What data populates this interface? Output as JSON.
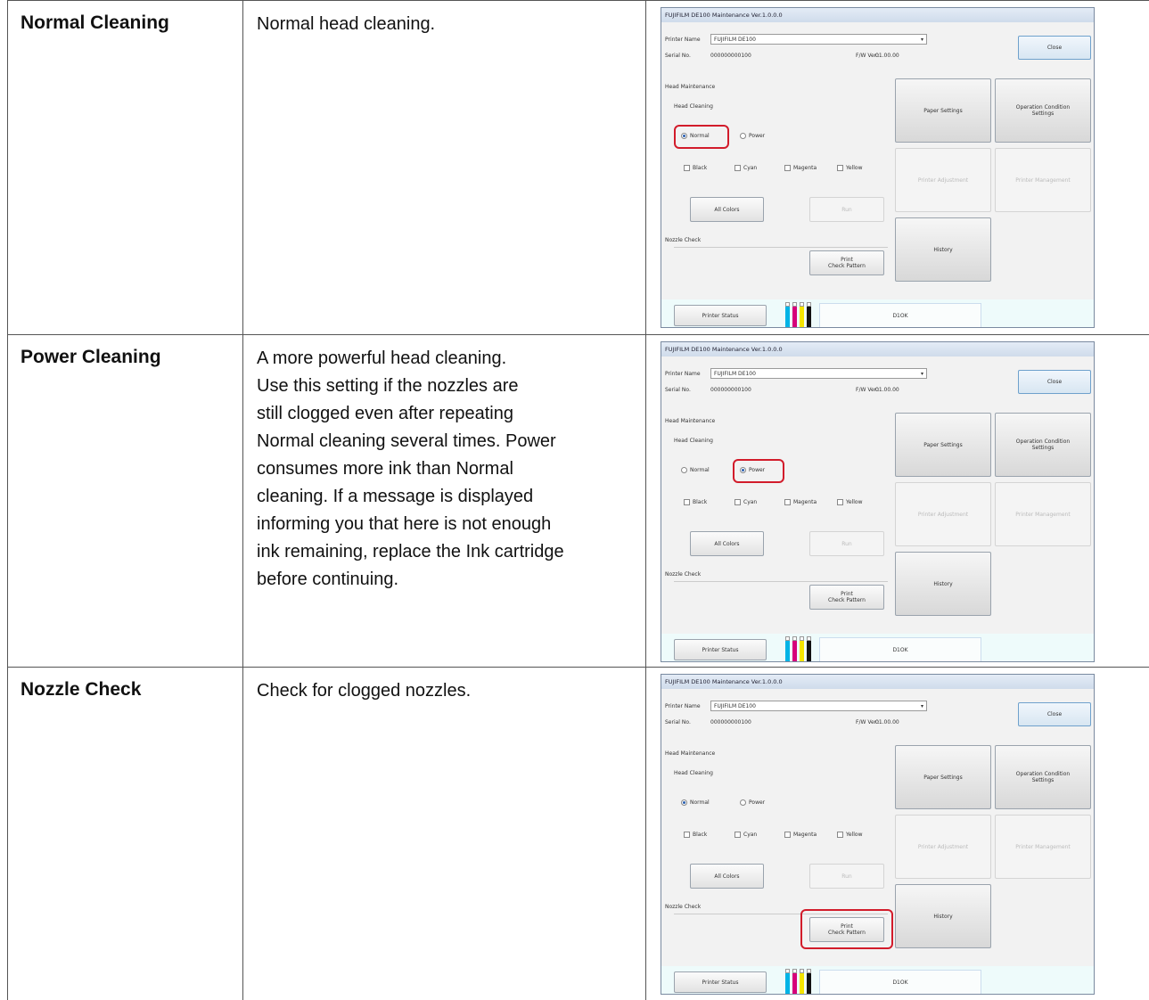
{
  "rows": [
    {
      "term": "Normal Cleaning",
      "description": [
        "Normal head cleaning."
      ],
      "highlight": "normal-radio"
    },
    {
      "term": "Power Cleaning",
      "description": [
        "A more powerful head cleaning.",
        "Use this setting if the nozzles are",
        "still clogged even after repeating",
        "Normal cleaning several times. Power",
        "consumes more ink than Normal",
        "cleaning. If a message is displayed",
        "informing you that here is not enough",
        "ink remaining, replace the Ink cartridge",
        "before continuing."
      ],
      "highlight": "power-radio"
    },
    {
      "term": "Nozzle Check",
      "description": [
        "Check for clogged nozzles."
      ],
      "highlight": "print-check-pattern"
    }
  ],
  "window": {
    "title": "FUJIFILM DE100 Maintenance Ver.1.0.0.0",
    "printer_name_label": "Printer Name",
    "printer_name_value": "FUJIFILM DE100",
    "serial_label": "Serial No.",
    "serial_value": "000000000100",
    "fw_label": "F/W Ver.:",
    "fw_value": "01.00.00",
    "close": "Close",
    "head_maintenance": "Head Maintenance",
    "head_cleaning": "Head Cleaning",
    "normal": "Normal",
    "power": "Power",
    "black": "Black",
    "cyan": "Cyan",
    "magenta": "Magenta",
    "yellow": "Yellow",
    "all_colors": "All Colors",
    "run": "Run",
    "nozzle_check": "Nozzle Check",
    "print_check_1": "Print",
    "print_check_2": "Check Pattern",
    "paper_settings": "Paper Settings",
    "op_cond_1": "Operation Condition",
    "op_cond_2": "Settings",
    "printer_adjustment": "Printer Adjustment",
    "printer_management": "Printer Management",
    "history": "History",
    "printer_status": "Printer Status",
    "status_text": "D1OK",
    "ink_colors": [
      "#00b4e6",
      "#d6007a",
      "#f4e400",
      "#111111"
    ],
    "highlight_color": "#d21c2b"
  }
}
